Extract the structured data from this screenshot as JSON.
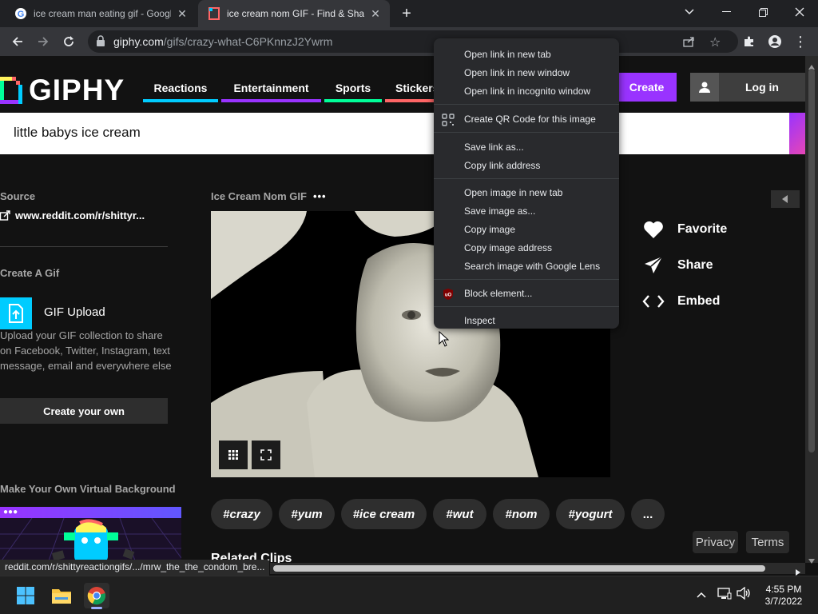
{
  "browser": {
    "tabs": [
      {
        "title": "ice cream man eating gif - Google",
        "active": false
      },
      {
        "title": "ice cream nom GIF - Find & Share",
        "active": true
      }
    ],
    "url_host": "giphy.com",
    "url_path": "/gifs/crazy-what-C6PKnnzJ2Ywrm",
    "status_url": "reddit.com/r/shittyreactiongifs/.../mrw_the_the_condom_bre..."
  },
  "header": {
    "logo_text": "GIPHY",
    "nav": [
      {
        "label": "Reactions",
        "color": "#00ccff"
      },
      {
        "label": "Entertainment",
        "color": "#9933ff"
      },
      {
        "label": "Sports",
        "color": "#00ff99"
      },
      {
        "label": "Stickers",
        "color": "#ff6666"
      }
    ],
    "create_label": "Create",
    "login_label": "Log in"
  },
  "search": {
    "query": "little babys ice cream"
  },
  "sidebar": {
    "source_heading": "Source",
    "source_link": "www.reddit.com/r/shittyr...",
    "create_heading": "Create A Gif",
    "upload_title": "GIF Upload",
    "upload_desc": "Upload your GIF collection to share on Facebook, Twitter, Instagram, text message, email and everywhere else",
    "create_own_label": "Create your own",
    "vbg_title": "Make Your Own Virtual Background",
    "vbg_dots": "●●●"
  },
  "gif": {
    "title": "Ice Cream Nom GIF",
    "more": "•••"
  },
  "actions": {
    "favorite": "Favorite",
    "share": "Share",
    "embed": "Embed"
  },
  "tags": [
    "#crazy",
    "#yum",
    "#ice cream",
    "#wut",
    "#nom",
    "#yogurt",
    "..."
  ],
  "related_heading": "Related Clips",
  "footer": {
    "privacy": "Privacy",
    "terms": "Terms"
  },
  "context_menu": {
    "groups": [
      [
        "Open link in new tab",
        "Open link in new window",
        "Open link in incognito window"
      ],
      [
        "Create QR Code for this image"
      ],
      [
        "Save link as...",
        "Copy link address"
      ],
      [
        "Open image in new tab",
        "Save image as...",
        "Copy image",
        "Copy image address",
        "Search image with Google Lens"
      ],
      [
        "Block element..."
      ],
      [
        "Inspect"
      ]
    ]
  },
  "taskbar": {
    "time": "4:55 PM",
    "date": "3/7/2022"
  }
}
